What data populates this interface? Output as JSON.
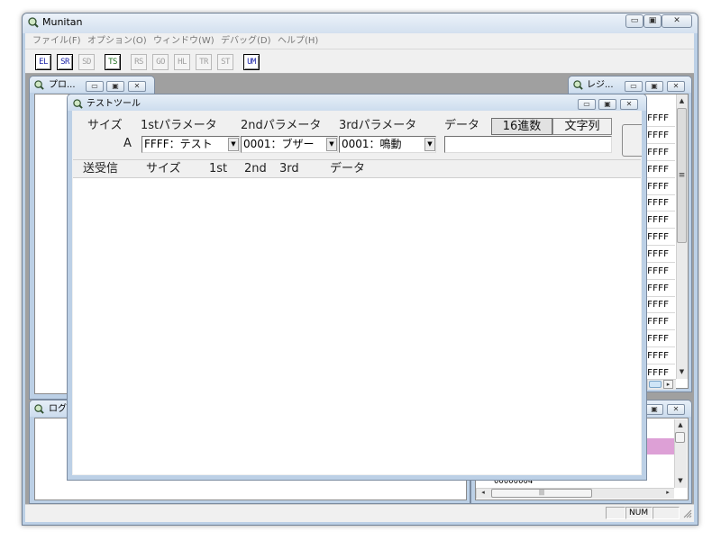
{
  "app": {
    "title": "Munitan"
  },
  "menu": [
    "ファイル(F)",
    "オプション(O)",
    "ウィンドウ(W)",
    "デバッグ(D)",
    "ヘルプ(H)"
  ],
  "toolbar": [
    {
      "label": "EL",
      "enabled": true
    },
    {
      "label": "SR",
      "enabled": true
    },
    {
      "label": "SD",
      "enabled": false
    },
    {
      "label": "TS",
      "enabled": true
    },
    {
      "label": "RS",
      "enabled": false
    },
    {
      "label": "GO",
      "enabled": false
    },
    {
      "label": "HL",
      "enabled": false
    },
    {
      "label": "TR",
      "enabled": false
    },
    {
      "label": "ST",
      "enabled": false
    },
    {
      "label": "UM",
      "enabled": true
    }
  ],
  "windows": {
    "program": {
      "title": "プロ..."
    },
    "log": {
      "title": "ログ"
    },
    "register": {
      "title": "レジ...",
      "values": [
        "FFFF",
        "FFFF",
        "FFFF",
        "FFFF",
        "FFFF",
        "FFFF",
        "FFFF",
        "FFFF",
        "FFFF",
        "FFFF",
        "FFFF",
        "FFFF",
        "FFFF",
        "FFFF",
        "FFFF",
        "FFFF",
        "FFFF"
      ]
    },
    "memory": {
      "address": "00000004"
    }
  },
  "testtool": {
    "title": "テストツール",
    "header_labels": {
      "size": "サイズ",
      "p1": "1stパラメータ",
      "p2": "2ndパラメータ",
      "p3": "3rdパラメータ",
      "data": "データ"
    },
    "data_modes": [
      "16進数",
      "文字列"
    ],
    "size_value": "A",
    "param1": "FFFF：テスト",
    "param2": "0001：ブザー",
    "param3": "0001：鳴動",
    "data_value": "",
    "list_columns": [
      "送受信",
      "サイズ",
      "1st",
      "2nd",
      "3rd",
      "データ"
    ]
  },
  "status": {
    "num": "NUM"
  }
}
